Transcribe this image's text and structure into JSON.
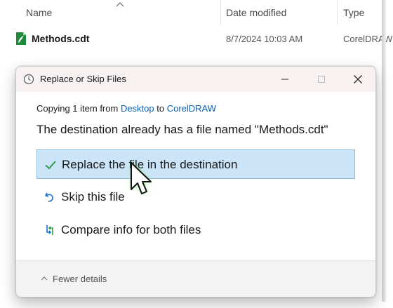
{
  "explorer": {
    "columns": [
      "Name",
      "Date modified",
      "Type"
    ],
    "file": {
      "name": "Methods.cdt",
      "date_modified": "8/7/2024 10:03 AM",
      "type": "CorelDRAW"
    }
  },
  "dialog": {
    "title": "Replace or Skip Files",
    "copying_prefix": "Copying 1 item from ",
    "source": "Desktop",
    "to_word": " to ",
    "destination": "CorelDRAW",
    "message": "The destination already has a file named \"Methods.cdt\"",
    "options": [
      {
        "label": "Replace the file in the destination",
        "icon": "checkmark-icon",
        "selected": true
      },
      {
        "label": "Skip this file",
        "icon": "skip-icon",
        "selected": false
      },
      {
        "label": "Compare info for both files",
        "icon": "compare-icon",
        "selected": false
      }
    ],
    "footer_label": "Fewer details"
  },
  "colors": {
    "link": "#0a5fb4",
    "selected_bg": "#cce4f7",
    "cursor_glow": "#7ff57a"
  }
}
